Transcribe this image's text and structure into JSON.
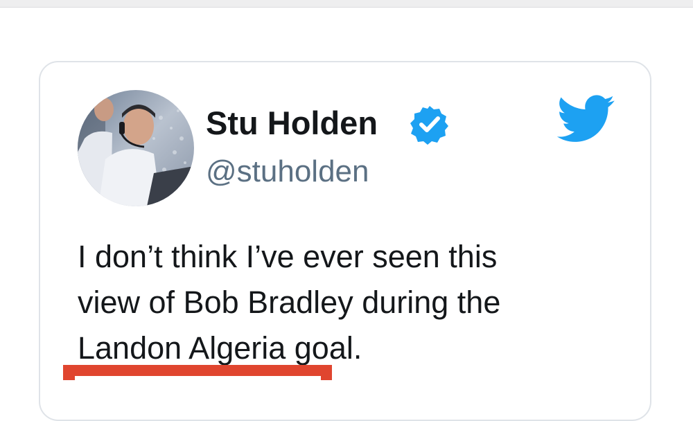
{
  "tweet": {
    "author": {
      "display_name": "Stu Holden",
      "handle": "@stuholden",
      "verified": true,
      "avatar_icon": "profile-photo"
    },
    "text_lines": [
      "I don’t think I’ve ever seen this",
      "view of Bob Bradley during the",
      "Landon Algeria goal."
    ],
    "platform_icon": "twitter-bird-icon"
  },
  "colors": {
    "brand_blue": "#1da1f2",
    "name_text": "#14171a",
    "handle_text": "#5b7083",
    "card_border": "#dfe3e8",
    "highlight_red": "#e0452f"
  }
}
